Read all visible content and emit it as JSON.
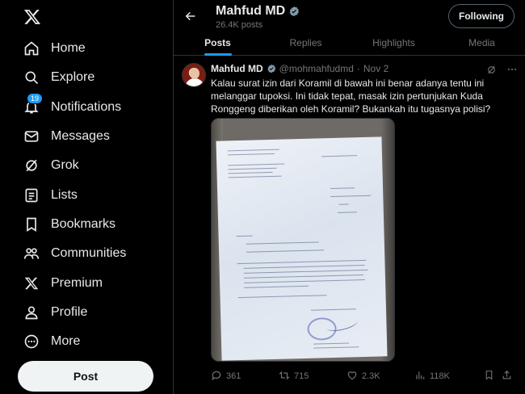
{
  "sidebar": {
    "logo": "X",
    "items": [
      {
        "label": "Home",
        "icon": "home-icon"
      },
      {
        "label": "Explore",
        "icon": "search-icon"
      },
      {
        "label": "Notifications",
        "icon": "bell-icon",
        "badge": "19"
      },
      {
        "label": "Messages",
        "icon": "envelope-icon"
      },
      {
        "label": "Grok",
        "icon": "grok-icon"
      },
      {
        "label": "Lists",
        "icon": "list-icon"
      },
      {
        "label": "Bookmarks",
        "icon": "bookmark-icon"
      },
      {
        "label": "Communities",
        "icon": "people-icon"
      },
      {
        "label": "Premium",
        "icon": "x-logo-icon"
      },
      {
        "label": "Profile",
        "icon": "person-icon"
      },
      {
        "label": "More",
        "icon": "more-circle-icon"
      }
    ],
    "post_button": "Post"
  },
  "header": {
    "name": "Mahfud MD",
    "post_count": "26.4K posts",
    "follow_button": "Following"
  },
  "tabs": [
    {
      "label": "Posts",
      "active": true
    },
    {
      "label": "Replies",
      "active": false
    },
    {
      "label": "Highlights",
      "active": false
    },
    {
      "label": "Media",
      "active": false
    }
  ],
  "tweet": {
    "name": "Mahfud MD",
    "handle": "@mohmahfudmd",
    "separator": "·",
    "date": "Nov 2",
    "text": "Kalau surat izin dari Koramil di bawah ini benar adanya tentu ini melanggar tupoksi. Ini tidak tepat, masak izin pertunjukan Kuda Ronggeng diberikan oleh Koramil? Bukankah itu tugasnya polisi?",
    "actions": {
      "replies": "361",
      "reposts": "715",
      "likes": "2.3K",
      "views": "118K"
    }
  },
  "colors": {
    "background": "#000000",
    "accent": "#1d9bf0",
    "text": "#e7e9ea",
    "muted": "#71767b",
    "border": "#2f3336"
  }
}
